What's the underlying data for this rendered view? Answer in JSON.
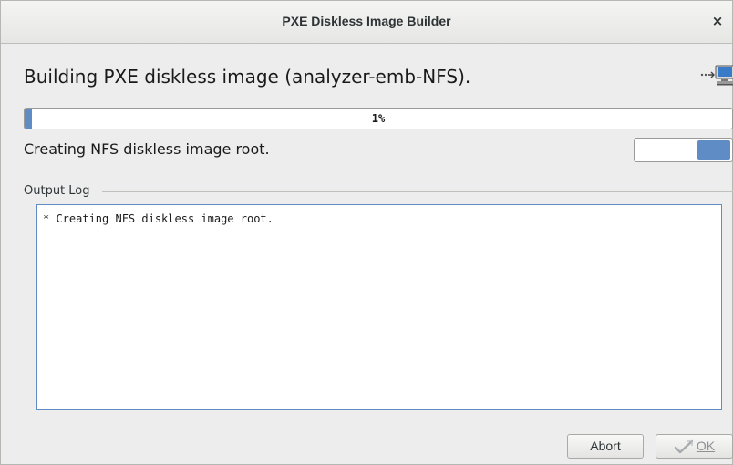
{
  "window": {
    "title": "PXE Diskless Image Builder",
    "close_glyph": "×"
  },
  "header": {
    "title": "Building PXE diskless image (analyzer-emb-NFS).",
    "icon": "deploy-to-computer-icon"
  },
  "progress": {
    "percent": 1,
    "label": "1%"
  },
  "status": {
    "text": "Creating NFS diskless image root."
  },
  "output_log": {
    "label": "Output Log",
    "text": "* Creating NFS diskless image root."
  },
  "buttons": {
    "abort_label": "Abort",
    "ok_label": "OK",
    "ok_icon": "check-icon"
  },
  "colors": {
    "accent": "#5f8cc4",
    "background": "#ededed"
  }
}
